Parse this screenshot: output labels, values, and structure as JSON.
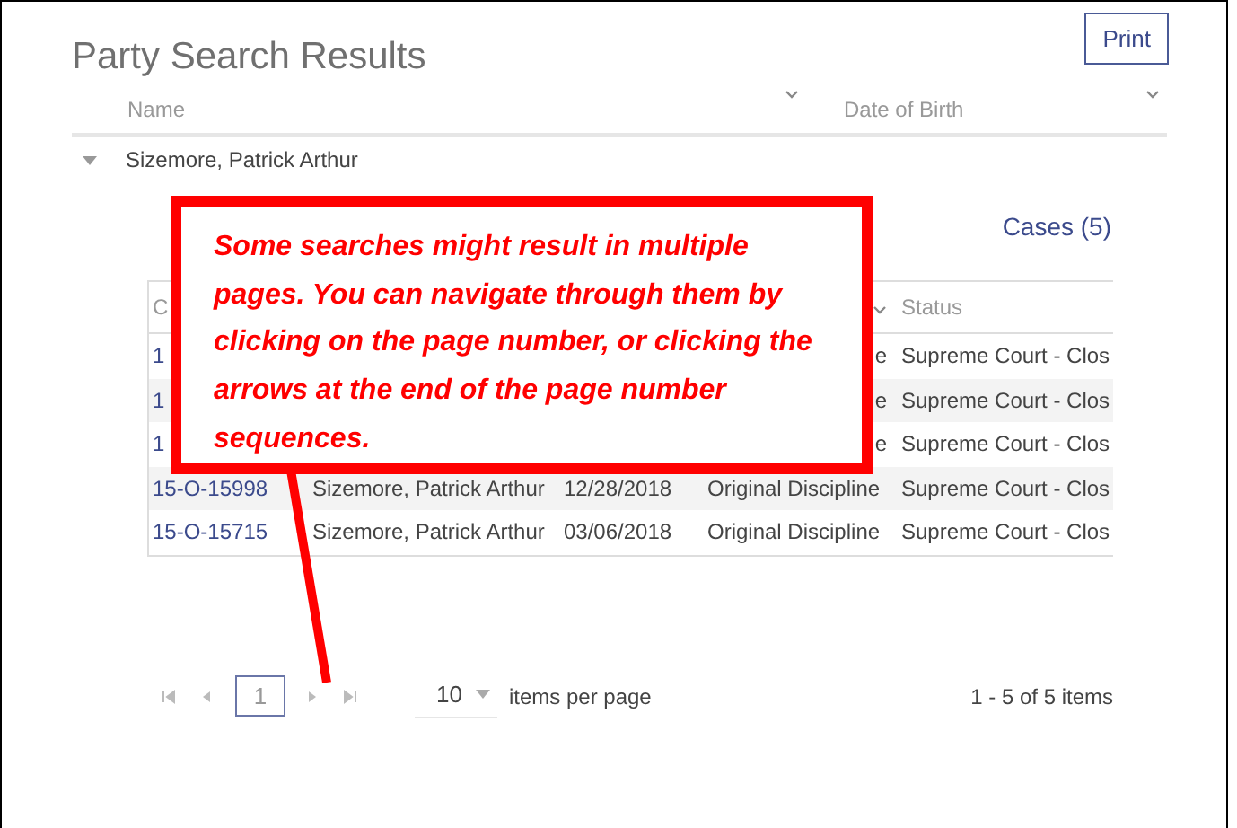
{
  "title": "Party Search Results",
  "print_button": "Print",
  "columns": [
    {
      "label": "Name"
    },
    {
      "label": "Date of Birth"
    }
  ],
  "parties": [
    {
      "name": "Sizemore, Patrick Arthur",
      "expanded": true
    }
  ],
  "cases_title": "Cases (5)",
  "cases_table": {
    "columns": [
      {
        "label": "C"
      },
      {
        "label": "Status"
      }
    ],
    "rows": [
      {
        "covered": true,
        "case_number": "1",
        "type": "e",
        "status": "Supreme Court - Clos"
      },
      {
        "covered": true,
        "case_number": "1",
        "type": "e",
        "status": "Supreme Court - Clos"
      },
      {
        "covered": true,
        "case_number": "1",
        "type": "e",
        "status": "Supreme Court - Clos"
      },
      {
        "covered": false,
        "case_number": "15-O-15998",
        "name": "Sizemore, Patrick Arthur",
        "date": "12/28/2018",
        "type": "Original Discipline",
        "status": "Supreme Court - Clos"
      },
      {
        "covered": false,
        "case_number": "15-O-15715",
        "name": "Sizemore, Patrick Arthur",
        "date": "03/06/2018",
        "type": "Original Discipline",
        "status": "Supreme Court - Clos"
      }
    ]
  },
  "pager": {
    "pages": [
      {
        "label": "1",
        "selected": true
      }
    ],
    "page_size": "10",
    "page_size_label": "items per page",
    "summary": "1 - 5 of 5 items"
  },
  "callout": {
    "text": "Some searches might result in multiple pages. You can navigate through them by clicking on the page number, or clicking the arrows at the end of the page number sequences."
  }
}
